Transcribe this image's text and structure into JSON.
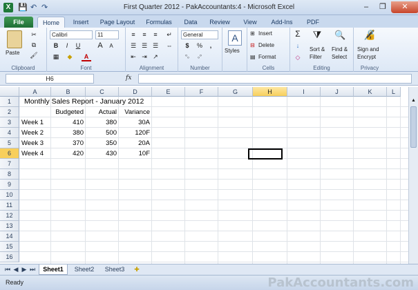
{
  "window": {
    "title": "First Quarter 2012 - PakAccountants:4  -  Microsoft Excel",
    "app_icon": "excel-icon",
    "qat": [
      "save-icon",
      "undo-icon",
      "redo-icon"
    ],
    "controls": [
      "–",
      "❐",
      "✕"
    ]
  },
  "ribbon_tabs": [
    "File",
    "Home",
    "Insert",
    "Page Layout",
    "Formulas",
    "Data",
    "Review",
    "View",
    "Add-Ins",
    "PDF"
  ],
  "ribbon": {
    "clipboard": {
      "paste": "Paste",
      "label": "Clipboard"
    },
    "font": {
      "name": "Calibri",
      "size": "11",
      "label": "Font",
      "bold": "B",
      "italic": "I",
      "underline": "U",
      "grow": "A",
      "shrink": "A",
      "color_letter": "A"
    },
    "alignment": {
      "label": "Alignment"
    },
    "number": {
      "format": "General",
      "currency": "$",
      "percent": "%",
      "comma": ",",
      "label": "Number"
    },
    "styles": {
      "label": "Styles"
    },
    "cells": {
      "insert": "Insert",
      "delete": "Delete",
      "format": "Format",
      "label": "Cells"
    },
    "editing": {
      "sort": "Sort &",
      "filter": "Filter",
      "find": "Find &",
      "select": "Select",
      "label": "Editing"
    },
    "privacy": {
      "sign": "Sign and",
      "encrypt": "Encrypt",
      "label": "Privacy"
    }
  },
  "formula_bar": {
    "name_box": "H6",
    "fx": "fx",
    "formula": ""
  },
  "columns": [
    "A",
    "B",
    "C",
    "D",
    "E",
    "F",
    "G",
    "H",
    "I",
    "J",
    "K",
    "L"
  ],
  "selected_column": "H",
  "rows": [
    "1",
    "2",
    "3",
    "4",
    "5",
    "6",
    "7",
    "8",
    "9",
    "10",
    "11",
    "12",
    "13",
    "14",
    "15",
    "16"
  ],
  "selected_row": "6",
  "sheet": {
    "title": "Monthly Sales Report - January 2012",
    "headers": [
      "Budgeted",
      "Actual",
      "Variance"
    ],
    "data": [
      {
        "week": "Week 1",
        "budgeted": "410",
        "actual": "380",
        "variance": "30A"
      },
      {
        "week": "Week 2",
        "budgeted": "380",
        "actual": "500",
        "variance": "120F"
      },
      {
        "week": "Week 3",
        "budgeted": "370",
        "actual": "350",
        "variance": "20A"
      },
      {
        "week": "Week 4",
        "budgeted": "420",
        "actual": "430",
        "variance": "10F"
      }
    ]
  },
  "sheet_tabs": [
    "Sheet1",
    "Sheet2",
    "Sheet3"
  ],
  "status": {
    "text": "Ready",
    "watermark": "PakAccountants.com"
  }
}
